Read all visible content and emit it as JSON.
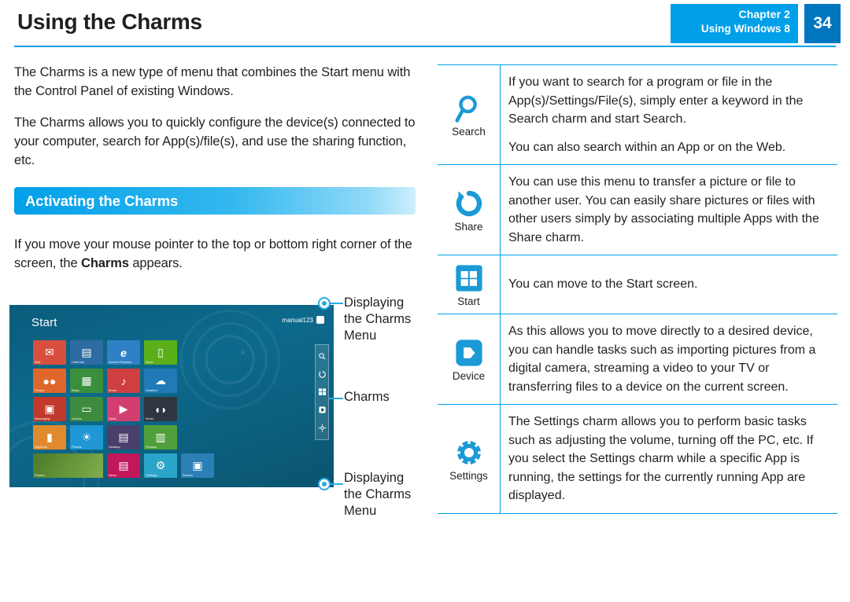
{
  "header": {
    "title": "Using the Charms",
    "chapter_line1": "Chapter 2",
    "chapter_line2": "Using Windows 8",
    "page_number": "34",
    "accent_color": "#00a0e9",
    "page_number_color": "#0076c0"
  },
  "left": {
    "paragraph1": "The Charms is a new type of menu that combines the Start menu with the Control Panel of existing Windows.",
    "paragraph2": "The Charms allows you to quickly configure the device(s) connected to your computer, search for App(s)/file(s), and use the sharing function, etc.",
    "section_title": "Activating the Charms",
    "paragraph3_pre": "If you move your mouse pointer to the top or bottom right corner of the screen, the ",
    "paragraph3_bold": "Charms",
    "paragraph3_post": " appears."
  },
  "screenshot": {
    "start_label": "Start",
    "user_name": "manual123",
    "tiles": [
      [
        {
          "caption": "Mail",
          "color": "#d94f3d",
          "icon": "✉"
        },
        {
          "caption": "Calendar",
          "color": "#2d6ca2",
          "icon": "▤"
        },
        {
          "caption": "Internet Explorer",
          "color": "#2f80c4",
          "icon": "e"
        },
        {
          "caption": "Store",
          "color": "#5bb01a",
          "icon": "🛍"
        }
      ],
      [
        {
          "caption": "People",
          "color": "#e0672b",
          "icon": "👥"
        },
        {
          "caption": "Maps",
          "color": "#3a8f3c",
          "icon": "▦"
        },
        {
          "caption": "Music",
          "color": "#cf3f3f",
          "icon": "♪"
        },
        {
          "caption": "Weather",
          "color": "#1f7ab5",
          "icon": "☁"
        }
      ],
      [
        {
          "caption": "Messaging",
          "color": "#c0392b",
          "icon": "▣"
        },
        {
          "caption": "Games",
          "color": "#3d8b3d",
          "icon": "🎮"
        },
        {
          "caption": "Video",
          "color": "#d23f6f",
          "icon": "▶"
        },
        {
          "caption": "Music",
          "color": "#2f3640",
          "icon": "🎧"
        }
      ],
      [
        {
          "caption": "SkyDrive",
          "color": "#e08a2e",
          "icon": "▮"
        },
        {
          "caption": "Photos",
          "color": "#1f97d4",
          "icon": "☀"
        },
        {
          "caption": "Desktop",
          "color": "#4a3f6b",
          "icon": "▤"
        },
        {
          "caption": "Finance",
          "color": "#4f9f3a",
          "icon": "📊"
        }
      ],
      [
        {
          "caption": "Photos",
          "color": "#5a8f3a",
          "icon": "🌿"
        },
        {
          "caption": "News",
          "color": "#c2185b",
          "icon": "▤"
        },
        {
          "caption": "Settings",
          "color": "#2aa5c9",
          "icon": "⚙"
        },
        {
          "caption": "Reader",
          "color": "#2b7fb5",
          "icon": "▣"
        }
      ]
    ],
    "charms_bar_icons": [
      "search-icon",
      "share-icon",
      "start-icon",
      "device-icon",
      "settings-icon"
    ],
    "callouts": [
      {
        "id": "top",
        "lines": [
          "Displaying",
          "the Charms",
          "Menu"
        ]
      },
      {
        "id": "middle",
        "lines": [
          "Charms"
        ]
      },
      {
        "id": "bottom",
        "lines": [
          "Displaying",
          "the Charms",
          "Menu"
        ]
      }
    ]
  },
  "charm_table": {
    "rows": [
      {
        "icon": "search-icon",
        "name": "Search",
        "paragraphs": [
          "If you want to search for a program or file in the App(s)/Settings/File(s), simply enter a keyword in the Search charm and start Search.",
          "You can also search within an App or on the Web."
        ]
      },
      {
        "icon": "share-icon",
        "name": "Share",
        "paragraphs": [
          "You can use this menu to transfer a picture or file to another user. You can easily share pictures or files with other users simply by associating multiple Apps with the Share charm."
        ]
      },
      {
        "icon": "start-icon",
        "name": "Start",
        "paragraphs": [
          "You can move to the Start screen."
        ]
      },
      {
        "icon": "device-icon",
        "name": "Device",
        "paragraphs": [
          "As this allows you to move directly to a desired device, you can handle tasks such as importing pictures from a digital camera, streaming a video to your TV or transferring files to a device on the current screen."
        ]
      },
      {
        "icon": "settings-icon",
        "name": "Settings",
        "paragraphs": [
          "The Settings charm allows you to perform basic tasks such as adjusting the volume, turning off the PC, etc. If you select the Settings charm while a specific App is running, the settings for the currently running App are displayed."
        ]
      }
    ]
  }
}
